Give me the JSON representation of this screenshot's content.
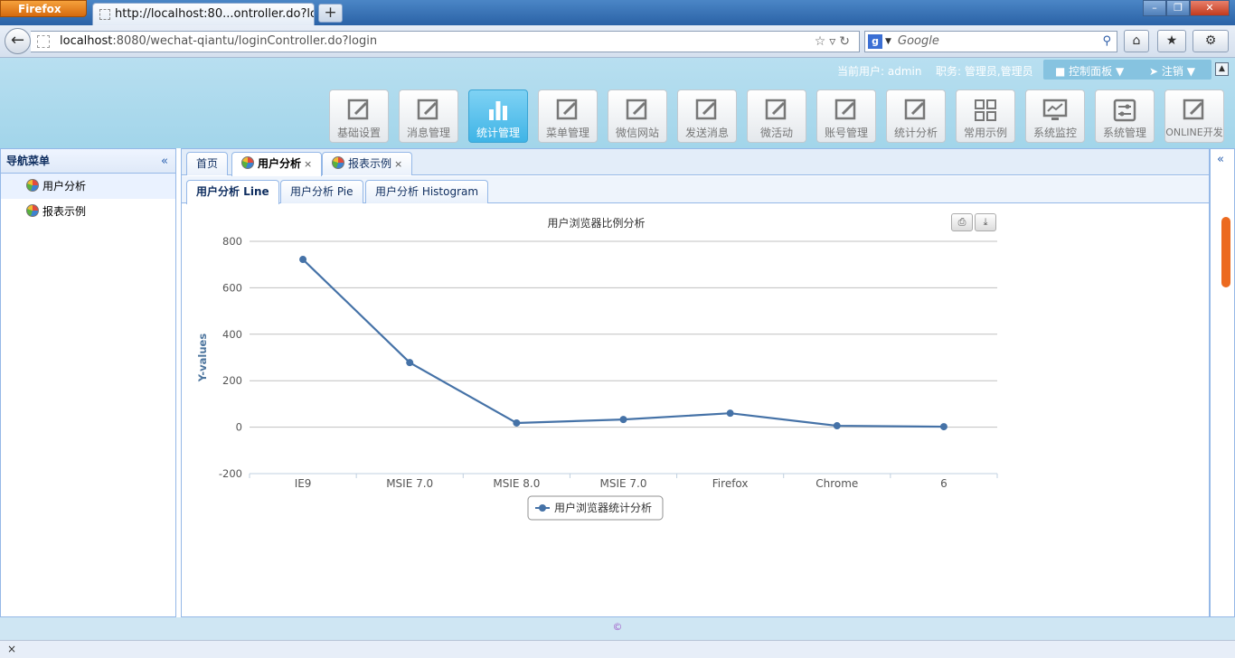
{
  "browser": {
    "menu_label": "Firefox",
    "tab_title": "http://localhost:80...ontroller.do?login",
    "url_host": "localhost",
    "url_rest": ":8080/wechat-qiantu/loginController.do?login",
    "search_placeholder": "Google"
  },
  "userbar": {
    "current_user": "当前用户: admin",
    "role": "职务: 管理员,管理员",
    "control_panel": "控制面板",
    "logout": "注销"
  },
  "menu": [
    {
      "label": "基础设置",
      "icon": "edit-icon"
    },
    {
      "label": "消息管理",
      "icon": "edit-icon"
    },
    {
      "label": "统计管理",
      "icon": "bar-chart-icon",
      "active": true
    },
    {
      "label": "菜单管理",
      "icon": "edit-icon"
    },
    {
      "label": "微信网站",
      "icon": "edit-icon"
    },
    {
      "label": "发送消息",
      "icon": "edit-icon"
    },
    {
      "label": "微活动",
      "icon": "edit-icon"
    },
    {
      "label": "账号管理",
      "icon": "edit-icon"
    },
    {
      "label": "统计分析",
      "icon": "edit-icon"
    },
    {
      "label": "常用示例",
      "icon": "grid-icon"
    },
    {
      "label": "系统监控",
      "icon": "monitor-icon"
    },
    {
      "label": "系统管理",
      "icon": "settings-icon"
    },
    {
      "label": "ONLINE开发",
      "icon": "edit-icon"
    }
  ],
  "leftnav": {
    "title": "导航菜单",
    "items": [
      {
        "label": "用户分析",
        "icon": "pie-chart-icon",
        "selected": true
      },
      {
        "label": "报表示例",
        "icon": "pie-chart-icon"
      }
    ]
  },
  "tabs": [
    {
      "label": "首页"
    },
    {
      "label": "用户分析",
      "selected": true,
      "closable": true
    },
    {
      "label": "报表示例",
      "closable": true
    }
  ],
  "subtabs": [
    {
      "label": "用户分析 Line",
      "selected": true
    },
    {
      "label": "用户分析 Pie"
    },
    {
      "label": "用户分析 Histogram"
    }
  ],
  "chart_data": {
    "type": "line",
    "title": "用户浏览器比例分析",
    "ylabel": "Y-values",
    "xlabel": "",
    "categories": [
      "IE9",
      "MSIE 7.0",
      "MSIE 8.0",
      "MSIE 7.0",
      "Firefox",
      "Chrome",
      "6"
    ],
    "series": [
      {
        "name": "用户浏览器统计分析",
        "values": [
          722,
          278,
          18,
          33,
          60,
          6,
          2
        ],
        "color": "#4572a7"
      }
    ],
    "ylim": [
      -200,
      800
    ],
    "yticks": [
      "800",
      "600",
      "400",
      "200",
      "0",
      "-200"
    ],
    "grid": true,
    "legend": "bottom-center"
  },
  "footer": "©"
}
